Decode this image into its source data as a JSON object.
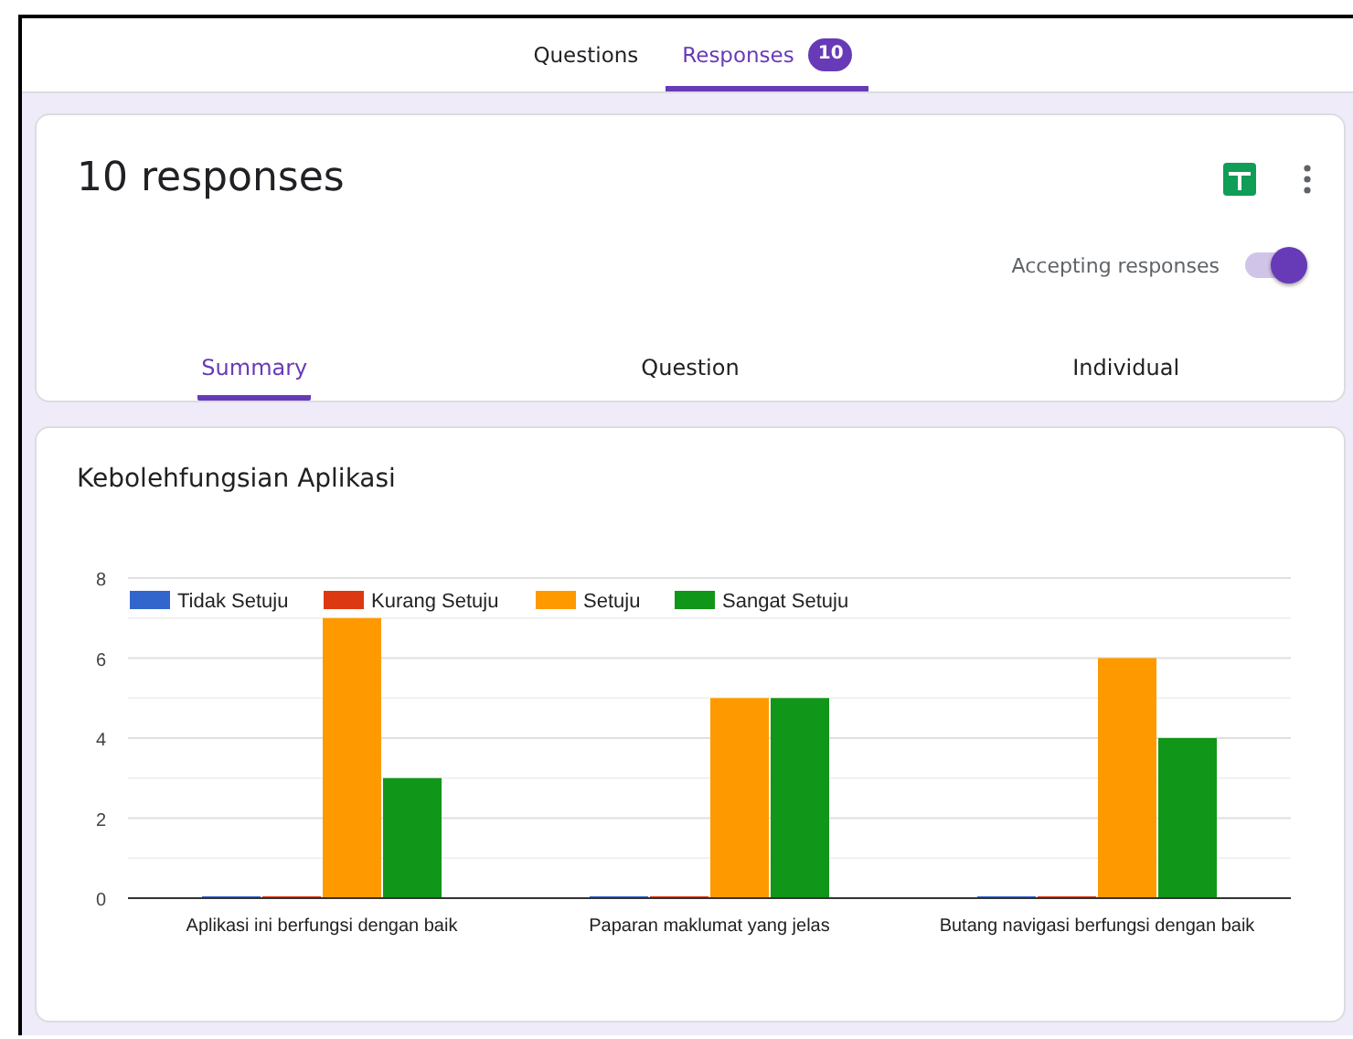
{
  "top_tabs": [
    {
      "label": "Questions",
      "selected": false
    },
    {
      "label": "Responses",
      "selected": true,
      "badge": "10"
    }
  ],
  "summary": {
    "title": "10 responses",
    "accepting": {
      "label": "Accepting responses",
      "on": true
    },
    "tabs": [
      {
        "label": "Summary",
        "selected": true
      },
      {
        "label": "Question",
        "selected": false
      },
      {
        "label": "Individual",
        "selected": false
      }
    ]
  },
  "question_card": {
    "title": "Kebolehfungsian Aplikasi",
    "chart_data": {
      "type": "bar",
      "categories": [
        "Aplikasi ini berfungsi dengan baik",
        "Paparan maklumat yang jelas",
        "Butang navigasi berfungsi dengan baik"
      ],
      "series": [
        {
          "name": "Tidak Setuju",
          "color": "#3366cc",
          "values": [
            0,
            0,
            0
          ]
        },
        {
          "name": "Kurang Setuju",
          "color": "#dc3912",
          "values": [
            0,
            0,
            0
          ]
        },
        {
          "name": "Setuju",
          "color": "#ff9900",
          "values": [
            7,
            5,
            6
          ]
        },
        {
          "name": "Sangat Setuju",
          "color": "#109618",
          "values": [
            3,
            5,
            4
          ]
        }
      ],
      "ylim": [
        0,
        8
      ],
      "yticks": [
        0,
        2,
        4,
        6,
        8
      ],
      "grid": true,
      "legend": true
    }
  }
}
